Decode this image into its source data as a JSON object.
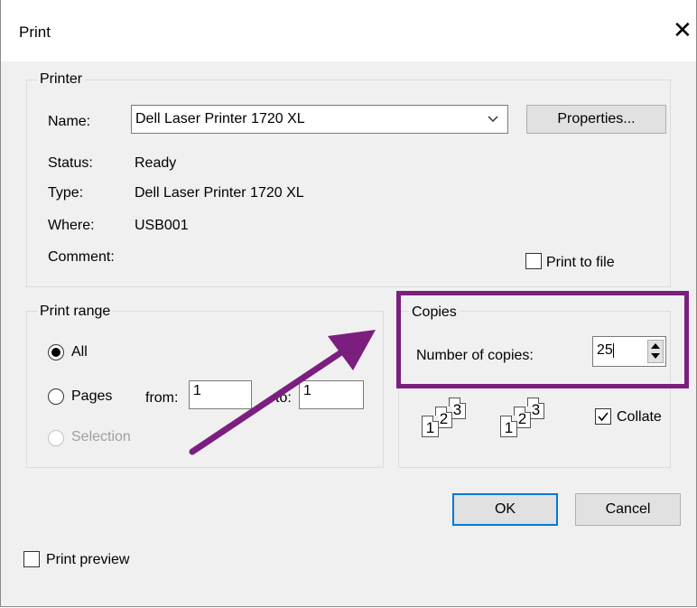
{
  "dialog": {
    "title": "Print",
    "close_glyph": "✕"
  },
  "printer": {
    "legend": "Printer",
    "name_label": "Name:",
    "name_value": "Dell Laser Printer 1720 XL",
    "properties_button": "Properties...",
    "status_label": "Status:",
    "status_value": "Ready",
    "type_label": "Type:",
    "type_value": "Dell Laser Printer 1720 XL",
    "where_label": "Where:",
    "where_value": "USB001",
    "comment_label": "Comment:",
    "print_to_file_label": "Print to file",
    "print_to_file_checked": false
  },
  "print_range": {
    "legend": "Print range",
    "all_label": "All",
    "pages_label": "Pages",
    "from_label": "from:",
    "from_value": "1",
    "to_label": "to:",
    "to_value": "1",
    "selection_label": "Selection",
    "selected": "All"
  },
  "copies": {
    "legend": "Copies",
    "number_label": "Number of copies:",
    "number_value": "25",
    "collate_label": "Collate",
    "collate_checked": true,
    "page_numbers": [
      "1",
      "2",
      "3"
    ]
  },
  "buttons": {
    "ok": "OK",
    "cancel": "Cancel"
  },
  "print_preview_label": "Print preview",
  "annotation": {
    "highlight_color": "#7b1e7e"
  }
}
